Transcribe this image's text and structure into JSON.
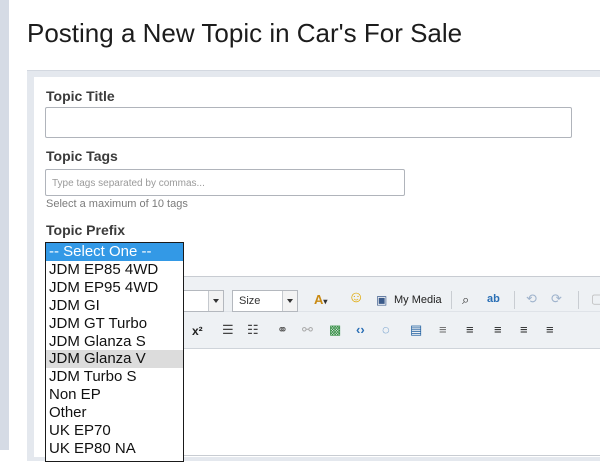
{
  "page": {
    "title": "Posting a New Topic in Car's For Sale"
  },
  "form": {
    "topic_title_label": "Topic Title",
    "topic_tags_label": "Topic Tags",
    "tags_placeholder": "Type tags separated by commas...",
    "tags_hint": "Select a maximum of 10 tags",
    "topic_prefix_label": "Topic Prefix"
  },
  "prefix_dropdown": {
    "options": [
      "-- Select One --",
      "JDM EP85 4WD",
      "JDM EP95 4WD",
      "JDM GI",
      "JDM GT Turbo",
      "JDM Glanza S",
      "JDM Glanza V",
      "JDM Turbo S",
      "Non EP",
      "Other",
      "UK EP70",
      "UK EP80 NA"
    ],
    "selected_index": 0,
    "hover_index": 6
  },
  "editor": {
    "size_label": "Size",
    "my_media_label": "My Media",
    "superscript_label": "x²",
    "icons": {
      "font_color": "font-color-icon",
      "emoticon": "smiley-icon",
      "media": "media-icon",
      "binoculars": "find-icon",
      "spellcheck": "spellcheck-icon",
      "undo": "undo-icon",
      "redo": "redo-icon"
    },
    "colors": {
      "toolbar_bg": "#eef1f4",
      "accent": "#3399e6"
    }
  }
}
